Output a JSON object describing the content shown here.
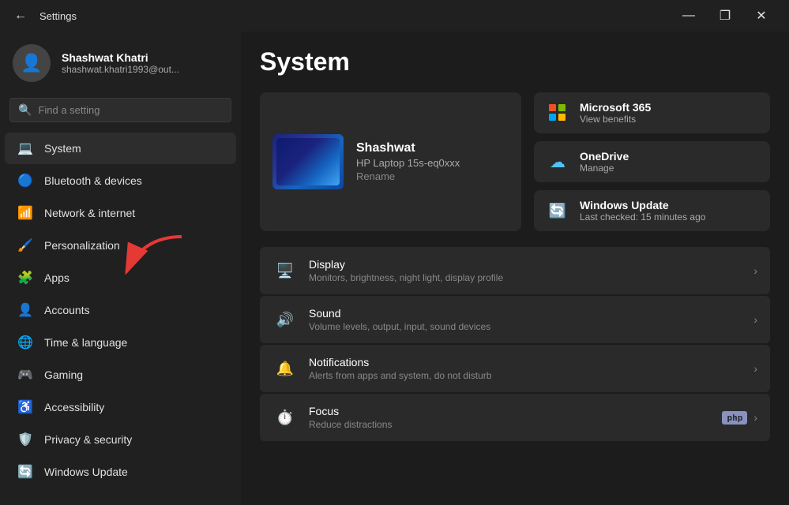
{
  "titlebar": {
    "title": "Settings",
    "back_label": "←",
    "minimize_label": "—",
    "maximize_label": "❐",
    "close_label": "✕"
  },
  "sidebar": {
    "user": {
      "name": "Shashwat Khatri",
      "email": "shashwat.khatri1993@out..."
    },
    "search": {
      "placeholder": "Find a setting"
    },
    "nav_items": [
      {
        "id": "system",
        "label": "System",
        "icon": "💻",
        "active": true
      },
      {
        "id": "bluetooth",
        "label": "Bluetooth & devices",
        "icon": "🔵",
        "active": false
      },
      {
        "id": "network",
        "label": "Network & internet",
        "icon": "📶",
        "active": false
      },
      {
        "id": "personalization",
        "label": "Personalization",
        "icon": "🖌️",
        "active": false
      },
      {
        "id": "apps",
        "label": "Apps",
        "icon": "🧩",
        "active": false
      },
      {
        "id": "accounts",
        "label": "Accounts",
        "icon": "👤",
        "active": false
      },
      {
        "id": "time",
        "label": "Time & language",
        "icon": "🌐",
        "active": false
      },
      {
        "id": "gaming",
        "label": "Gaming",
        "icon": "🎮",
        "active": false
      },
      {
        "id": "accessibility",
        "label": "Accessibility",
        "icon": "♿",
        "active": false
      },
      {
        "id": "privacy",
        "label": "Privacy & security",
        "icon": "🛡️",
        "active": false
      },
      {
        "id": "update",
        "label": "Windows Update",
        "icon": "🔄",
        "active": false
      }
    ]
  },
  "main": {
    "page_title": "System",
    "device": {
      "name": "Shashwat",
      "model": "HP Laptop 15s-eq0xxx",
      "rename": "Rename"
    },
    "side_cards": [
      {
        "id": "ms365",
        "title": "Microsoft 365",
        "subtitle": "View benefits"
      },
      {
        "id": "onedrive",
        "title": "OneDrive",
        "subtitle": "Manage"
      },
      {
        "id": "winupdate",
        "title": "Windows Update",
        "subtitle": "Last checked: 15 minutes ago"
      }
    ],
    "settings_items": [
      {
        "id": "display",
        "icon": "🖥️",
        "title": "Display",
        "desc": "Monitors, brightness, night light, display profile",
        "badge": null
      },
      {
        "id": "sound",
        "icon": "🔊",
        "title": "Sound",
        "desc": "Volume levels, output, input, sound devices",
        "badge": null
      },
      {
        "id": "notifications",
        "icon": "🔔",
        "title": "Notifications",
        "desc": "Alerts from apps and system, do not disturb",
        "badge": null
      },
      {
        "id": "focus",
        "icon": "⏱️",
        "title": "Focus",
        "desc": "Reduce distractions",
        "badge": "php"
      }
    ]
  }
}
